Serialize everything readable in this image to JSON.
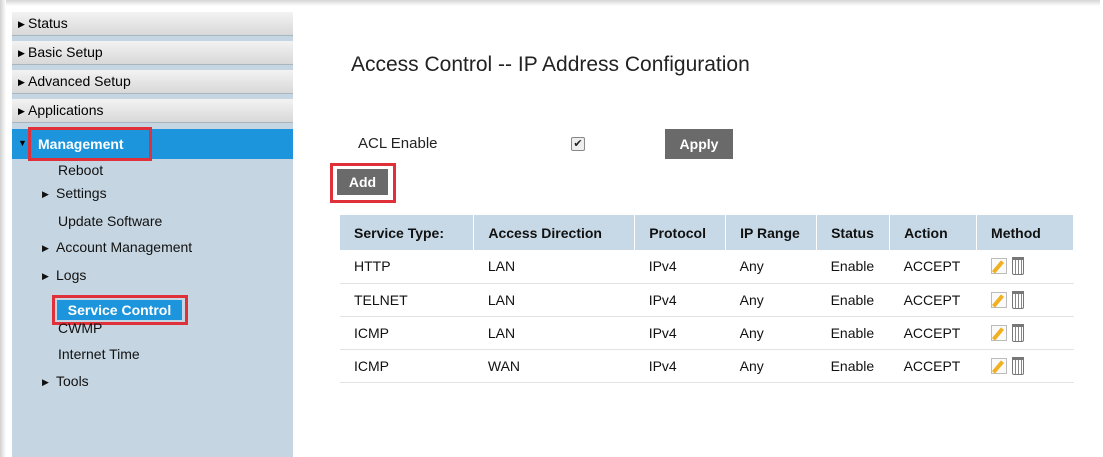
{
  "sidebar": {
    "top_items": [
      {
        "label": "Status"
      },
      {
        "label": "Basic Setup"
      },
      {
        "label": "Advanced Setup"
      },
      {
        "label": "Applications"
      }
    ],
    "active_section": "Management",
    "sub_items": {
      "reboot": "Reboot",
      "settings": "Settings",
      "update_software": "Update Software",
      "account_management": "Account Management",
      "logs": "Logs",
      "service_control": "Service Control",
      "cwmp": "CWMP",
      "internet_time": "Internet Time",
      "tools": "Tools"
    }
  },
  "main": {
    "title": "Access Control -- IP Address Configuration",
    "acl_label": "ACL Enable",
    "acl_enabled": true,
    "apply_label": "Apply",
    "add_label": "Add"
  },
  "table": {
    "headers": {
      "service_type": "Service Type:",
      "access_direction": "Access Direction",
      "protocol": "Protocol",
      "ip_range": "IP Range",
      "status": "Status",
      "action": "Action",
      "method": "Method"
    },
    "rows": [
      {
        "service": "HTTP",
        "direction": "LAN",
        "protocol": "IPv4",
        "ip_range": "Any",
        "status": "Enable",
        "action": "ACCEPT"
      },
      {
        "service": "TELNET",
        "direction": "LAN",
        "protocol": "IPv4",
        "ip_range": "Any",
        "status": "Enable",
        "action": "ACCEPT"
      },
      {
        "service": "ICMP",
        "direction": "LAN",
        "protocol": "IPv4",
        "ip_range": "Any",
        "status": "Enable",
        "action": "ACCEPT"
      },
      {
        "service": "ICMP",
        "direction": "WAN",
        "protocol": "IPv4",
        "ip_range": "Any",
        "status": "Enable",
        "action": "ACCEPT"
      }
    ]
  },
  "colors": {
    "sidebar_bg": "#c5d6e2",
    "active_blue": "#1d95dd",
    "highlight_red": "#e0313a",
    "button_gray": "#6a6a6a",
    "table_header": "#c7d9e6"
  },
  "icons": {
    "edit": "pencil-edit-icon",
    "delete": "trash-icon"
  }
}
